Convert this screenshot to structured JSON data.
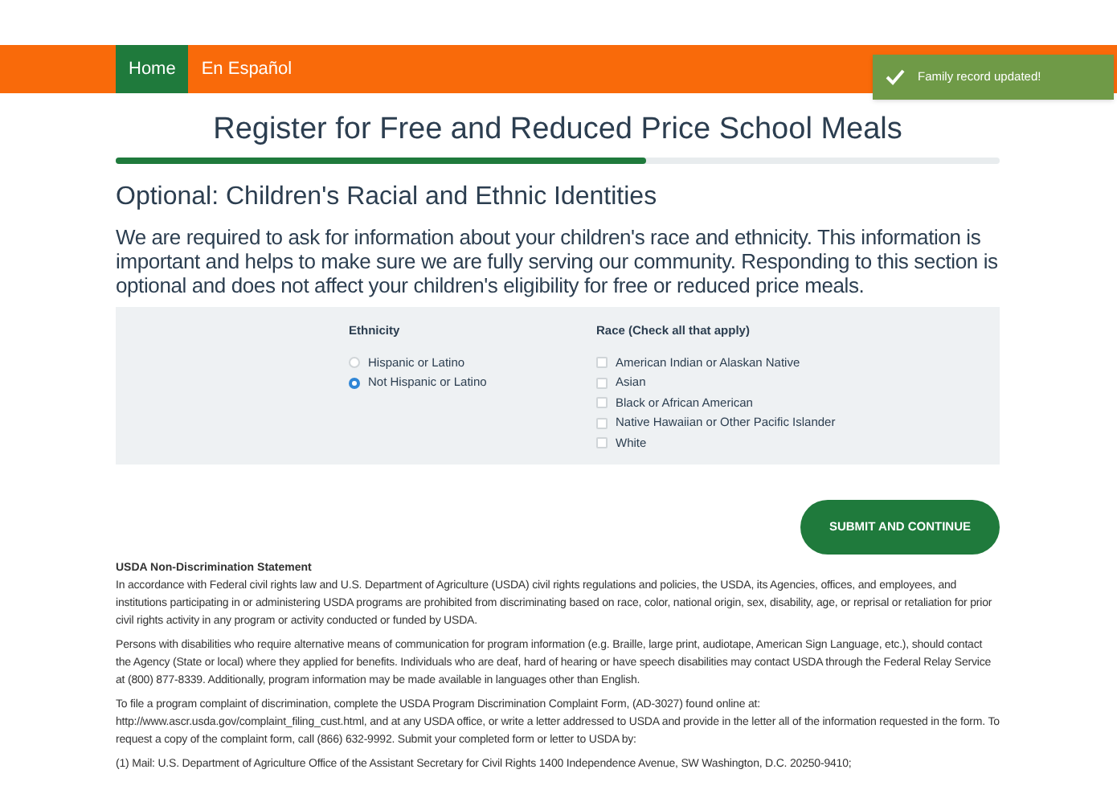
{
  "nav": {
    "items": [
      {
        "label": "Home",
        "selected": true
      },
      {
        "label": "En Español",
        "selected": false
      }
    ]
  },
  "toast": {
    "message": "Family record updated!"
  },
  "title": "Register for Free and Reduced Price School Meals",
  "progress": {
    "level": 0.6
  },
  "section": {
    "heading": "Optional: Children's Racial and Ethnic Identities",
    "intro": "We are required to ask for information about your children's race and ethnicity. This information is important and helps to make sure we are fully serving our community. Responding to this section is optional and does not affect your children's eligibility for free or reduced price meals."
  },
  "ethnicity": {
    "label": "Ethnicity",
    "options": [
      {
        "label": "Hispanic or Latino",
        "selected": false
      },
      {
        "label": "Not Hispanic or Latino",
        "selected": true
      }
    ]
  },
  "race": {
    "label": "Race (Check all that apply)",
    "options": [
      {
        "label": "American Indian or Alaskan Native",
        "checked": false
      },
      {
        "label": "Asian",
        "checked": false
      },
      {
        "label": "Black or African American",
        "checked": false
      },
      {
        "label": "Native Hawaiian or Other Pacific Islander",
        "checked": false
      },
      {
        "label": "White",
        "checked": false
      }
    ]
  },
  "submit_button": "SUBMIT AND CONTINUE",
  "statement": {
    "heading": "USDA Non-Discrimination Statement",
    "paragraphs": [
      "In accordance with Federal civil rights law and U.S. Department of Agriculture (USDA) civil rights regulations and policies, the USDA, its Agencies, offices, and employees, and institutions participating in or administering USDA programs are prohibited from discriminating based on race, color, national origin, sex, disability, age, or reprisal or retaliation for prior civil rights activity in any program or activity conducted or funded by USDA.",
      "Persons with disabilities who require alternative means of communication for program information (e.g. Braille, large print, audiotape, American Sign Language, etc.), should contact the Agency (State or local) where they applied for benefits. Individuals who are deaf, hard of hearing or have speech disabilities may contact USDA through the Federal Relay Service at (800) 877-8339. Additionally, program information may be made available in languages other than English.",
      "To file a program complaint of discrimination, complete the USDA Program Discrimination Complaint Form, (AD-3027) found online at: http://www.ascr.usda.gov/complaint_filing_cust.html, and at any USDA office, or write a letter addressed to USDA and provide in the letter all of the information requested in the form. To request a copy of the complaint form, call (866) 632-9992. Submit your completed form or letter to USDA by:",
      "(1) Mail: U.S. Department of Agriculture Office of the Assistant Secretary for Civil Rights 1400 Independence Avenue, SW Washington, D.C. 20250-9410;"
    ]
  }
}
